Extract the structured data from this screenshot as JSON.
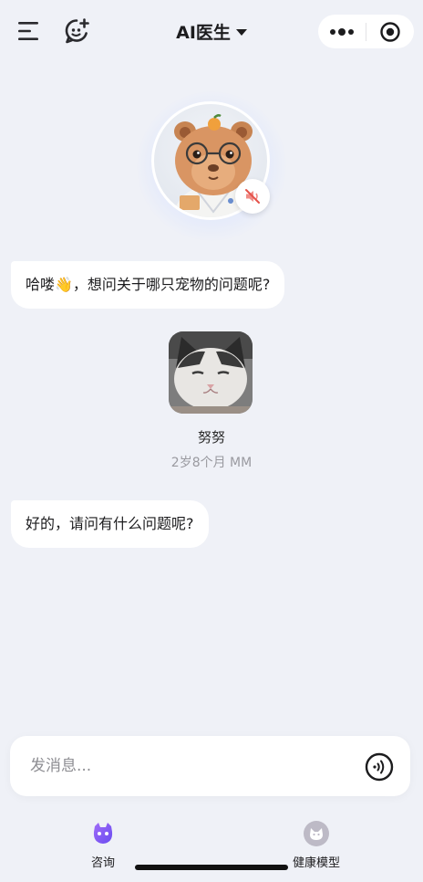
{
  "header": {
    "title": "AI医生",
    "icons": [
      "menu-icon",
      "chat-add-icon",
      "more-dots-icon",
      "target-icon"
    ]
  },
  "assistant": {
    "avatar": "doctor-capybara-avatar",
    "mute_icon": "speaker-muted-icon"
  },
  "messages": [
    {
      "role": "assistant",
      "text": "哈喽👋，想问关于哪只宠物的问题呢?"
    },
    {
      "role": "assistant",
      "text": "好的，请问有什么问题呢?"
    }
  ],
  "pet": {
    "name": "努努",
    "info": "2岁8个月 MM",
    "photo": "cat-photo"
  },
  "composer": {
    "placeholder": "发消息...",
    "voice_icon": "voice-wave-icon"
  },
  "tabs": [
    {
      "label": "咨询",
      "icon": "consult-bot-icon",
      "active": true,
      "color": "#7b5cf6"
    },
    {
      "label": "健康模型",
      "icon": "cat-model-icon",
      "active": false,
      "color": "#b3b0bd"
    }
  ]
}
